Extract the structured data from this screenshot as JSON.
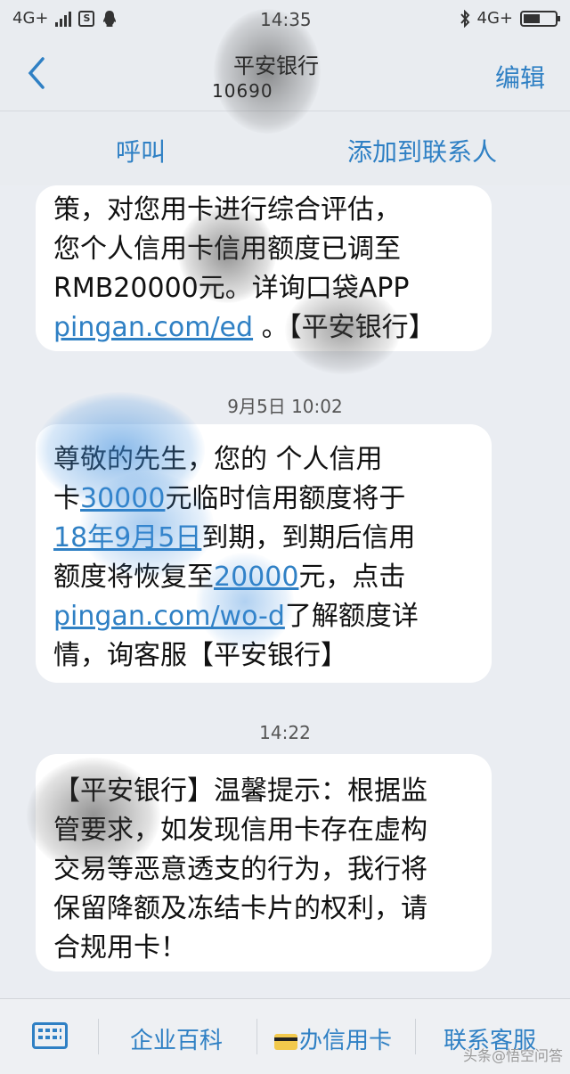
{
  "status_bar": {
    "network_left": "4G+",
    "time": "14:35",
    "network_right": "4G+"
  },
  "header": {
    "contact_name": "平安银行",
    "contact_number": "10690",
    "edit_label": "编辑"
  },
  "actions": {
    "call_label": "呼叫",
    "add_contact_label": "添加到联系人"
  },
  "messages": [
    {
      "lines": [
        {
          "text": "策，对您用卡进行综合评估，"
        },
        {
          "text": "您个人信用卡信用额度已调至"
        },
        {
          "text": "RMB20000元。详询口袋APP"
        },
        {
          "link": "pingan.com/ed",
          "text": " 。【平安银行】"
        }
      ]
    },
    {
      "timestamp": "9月5日 10:02",
      "lines": [
        {
          "text": "尊敬的先生，您的 个人信用"
        },
        {
          "pre": "卡",
          "link": "30000",
          "text": "元临时信用额度将于"
        },
        {
          "link": "18年9月5日",
          "text": "到期，到期后信用"
        },
        {
          "pre": "额度将恢复至",
          "link": "20000",
          "text": "元，点击"
        },
        {
          "link": "pingan.com/wo-d",
          "text": "了解额度详"
        },
        {
          "text": "情，询客服【平安银行】"
        }
      ]
    },
    {
      "timestamp": "14:22",
      "lines": [
        {
          "text": "【平安银行】温馨提示：根据监"
        },
        {
          "text": "管要求，如发现信用卡存在虚构"
        },
        {
          "text": "交易等恶意透支的行为，我行将"
        },
        {
          "text": "保留降额及冻结卡片的权利，请"
        },
        {
          "text": "合规用卡！"
        }
      ]
    }
  ],
  "bottom_menu": {
    "item1": "企业百科",
    "item2": "办信用卡",
    "item3": "联系客服"
  },
  "watermark": "头条@悟空问答",
  "colors": {
    "accent": "#2f80c4",
    "background": "#eaedf2",
    "bubble": "#ffffff"
  }
}
